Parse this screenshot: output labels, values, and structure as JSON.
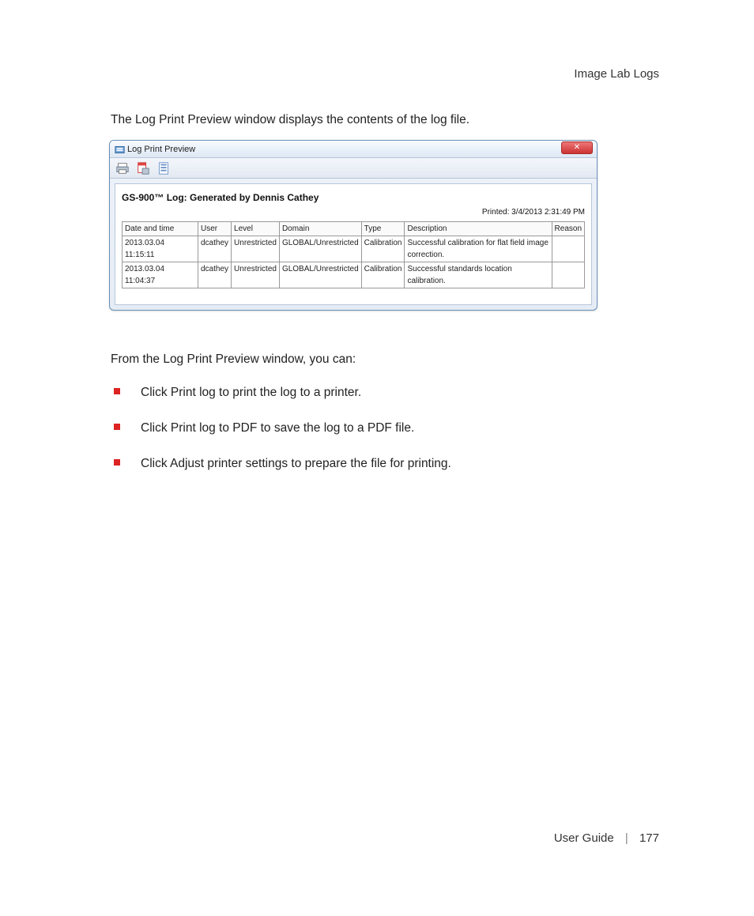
{
  "header": {
    "section_title": "Image Lab Logs"
  },
  "intro_paragraph": "The Log Print Preview window displays the contents of the log file.",
  "window": {
    "title": "Log Print Preview",
    "close_glyph": "✕",
    "report_title": "GS-900™ Log: Generated by Dennis Cathey",
    "printed_line": "Printed: 3/4/2013 2:31:49 PM",
    "columns": [
      "Date and time",
      "User",
      "Level",
      "Domain",
      "Type",
      "Description",
      "Reason"
    ],
    "rows": [
      {
        "dt": "2013.03.04 11:15:11",
        "user": "dcathey",
        "level": "Unrestricted",
        "domain": "GLOBAL/Unrestricted",
        "type": "Calibration",
        "desc": "Successful calibration for flat field image correction.",
        "reason": ""
      },
      {
        "dt": "2013.03.04 11:04:37",
        "user": "dcathey",
        "level": "Unrestricted",
        "domain": "GLOBAL/Unrestricted",
        "type": "Calibration",
        "desc": "Successful standards location calibration.",
        "reason": ""
      }
    ]
  },
  "below_intro": "From the Log Print Preview window, you can:",
  "bullets": [
    "Click Print log to print the log to a printer.",
    "Click Print log to PDF to save the log to a PDF file.",
    "Click Adjust printer settings to prepare the file for printing."
  ],
  "footer": {
    "label": "User Guide",
    "page": "177"
  }
}
